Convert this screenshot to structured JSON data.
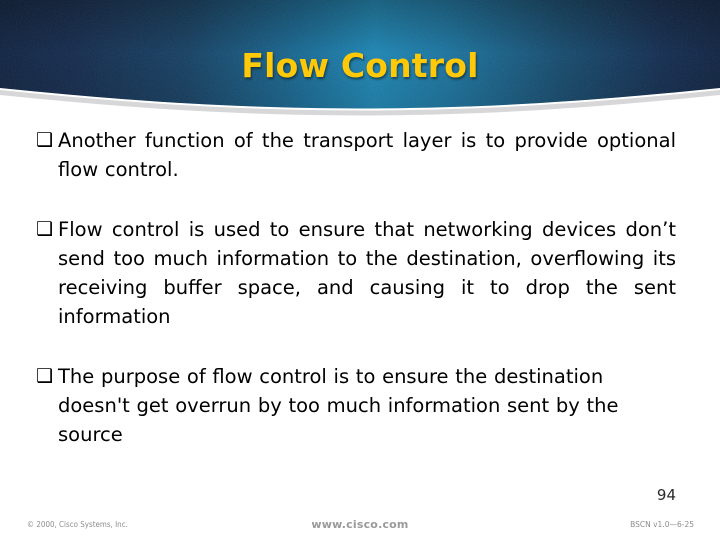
{
  "slide": {
    "title": "Flow Control",
    "title_color": "#FFC907",
    "banner_color_edge": "#13294b",
    "banner_color_center": "#1a7fae",
    "page_number": "94",
    "bullet_glyph": "❑",
    "bullets": [
      {
        "id": "bullet-1",
        "text": "Another function of the transport layer is to provide optional flow control."
      },
      {
        "id": "bullet-2",
        "text": "Flow control is used to ensure that networking devices don’t send too much information to the destination, overflowing its receiving buffer space, and causing it to drop the sent information"
      },
      {
        "id": "bullet-3",
        "text": "The purpose of flow control is to ensure the destination doesn't get overrun by too much information sent by the source"
      }
    ]
  },
  "footer": {
    "copyright": "© 2000, Cisco Systems, Inc.",
    "url": "www.cisco.com",
    "doc_id": "BSCN v1.0—6-25"
  }
}
